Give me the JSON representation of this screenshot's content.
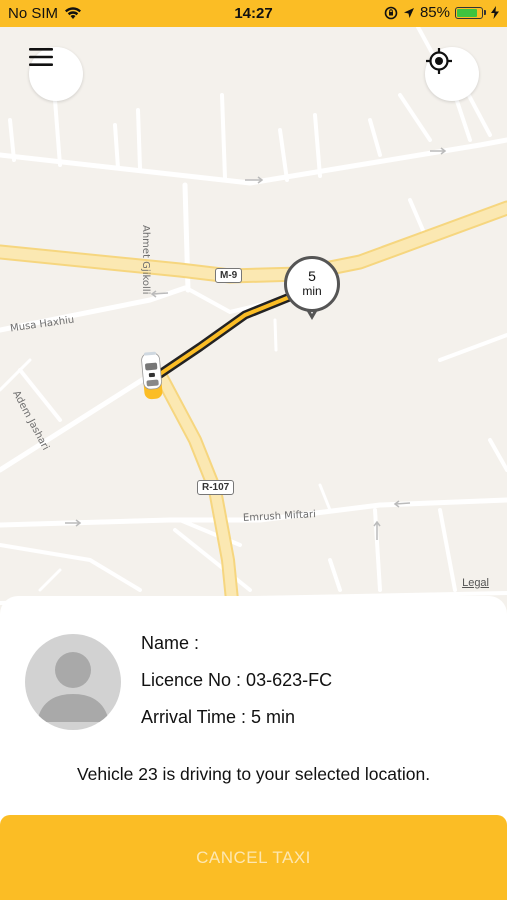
{
  "status_bar": {
    "carrier": "No SIM",
    "time": "14:27",
    "battery_percent": "85%",
    "battery_level": 0.85,
    "background_color": "#fbbd25"
  },
  "map": {
    "road_labels": {
      "ahmet": "Ahmet Gjikolli",
      "musa": "Musa Haxhiu",
      "adem": "Adem Jashari",
      "emrush": "Emrush Miftari"
    },
    "shields": {
      "m9": "M-9",
      "r107": "R-107"
    },
    "legal": "Legal",
    "eta": {
      "value": "5",
      "unit": "min"
    },
    "buttons": {
      "menu_icon": "hamburger-icon",
      "locate_icon": "location-target-icon"
    },
    "route_color": "#fbbd25"
  },
  "driver": {
    "name": "Name :",
    "licence": "Licence No : 03-623-FC",
    "arrival": "Arrival Time : 5 min"
  },
  "message": "Vehicle 23 is driving to your selected location.",
  "cancel_label": "CANCEL TAXI",
  "accent_color": "#fbbd25"
}
